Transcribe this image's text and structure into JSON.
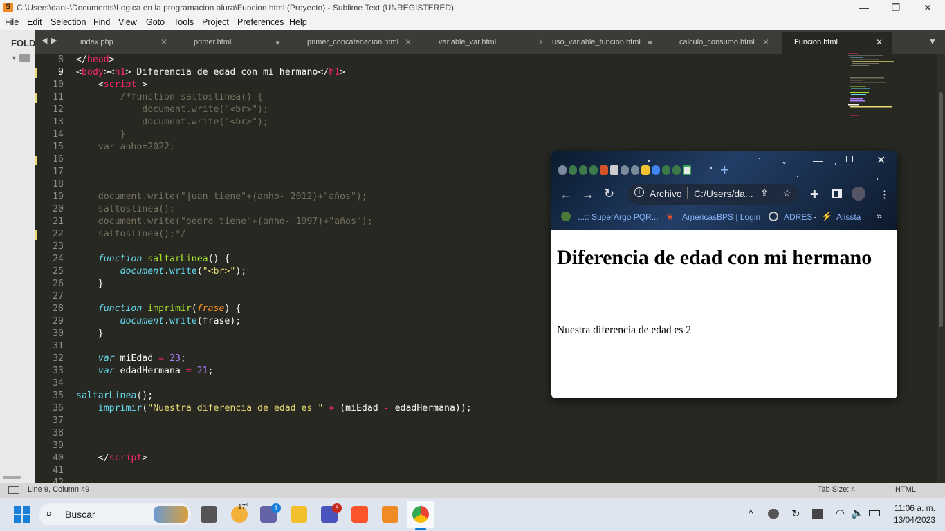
{
  "titlebar": {
    "title": "C:\\Users\\dani-\\Documents\\Logica en la programacion alura\\Funcion.html (Proyecto) - Sublime Text (UNREGISTERED)"
  },
  "menu": [
    "File",
    "Edit",
    "Selection",
    "Find",
    "View",
    "Goto",
    "Tools",
    "Project",
    "Preferences",
    "Help"
  ],
  "sidebar": {
    "label": "FOLD"
  },
  "tabs": [
    {
      "label": "index.php",
      "close": "✕",
      "active": false
    },
    {
      "label": "primer.html",
      "close": "●",
      "active": false
    },
    {
      "label": "primer_concatenacion.html",
      "close": "✕",
      "active": false
    },
    {
      "label": "variable_var.html",
      "close": "✕",
      "active": false
    },
    {
      "label": "uso_variable_funcion.html",
      "close": "●",
      "active": false
    },
    {
      "label": "calculo_consumo.html",
      "close": "✕",
      "active": false
    },
    {
      "label": "Funcion.html",
      "close": "✕",
      "active": true
    }
  ],
  "code_lines": [
    {
      "n": "8",
      "mark": false,
      "html": "<span>&lt;/</span><span class=\"tg\">head</span><span>&gt;</span>"
    },
    {
      "n": "9",
      "mark": true,
      "html": "<span>&lt;</span><span class=\"tg\">body</span><span>&gt;&lt;</span><span class=\"tg\">h1</span><span>&gt; Diferencia de edad con mi hermano&lt;/</span><span class=\"tg\">h1</span><span>&gt;</span>"
    },
    {
      "n": "10",
      "mark": false,
      "html": "    <span>&lt;</span><span class=\"tg\">script</span><span> &gt;</span>"
    },
    {
      "n": "11",
      "mark": true,
      "html": "<span class=\"cm\">        /*function saltoslinea() {</span>"
    },
    {
      "n": "12",
      "mark": false,
      "html": "<span class=\"cm\">            document.write(\"&lt;br&gt;\");</span>"
    },
    {
      "n": "13",
      "mark": false,
      "html": "<span class=\"cm\">            document.write(\"&lt;br&gt;\");</span>"
    },
    {
      "n": "14",
      "mark": false,
      "html": "<span class=\"cm\">        }</span>"
    },
    {
      "n": "15",
      "mark": false,
      "html": "<span class=\"cm\">    var anho=2022;</span>"
    },
    {
      "n": "16",
      "mark": true,
      "html": ""
    },
    {
      "n": "17",
      "mark": false,
      "html": ""
    },
    {
      "n": "18",
      "mark": false,
      "html": ""
    },
    {
      "n": "19",
      "mark": false,
      "html": "<span class=\"cm\">    document.write(\"juan tiene\"+(anho- 2012)+\"años\");</span>"
    },
    {
      "n": "20",
      "mark": false,
      "html": "<span class=\"cm\">    saltoslinea();</span>"
    },
    {
      "n": "21",
      "mark": false,
      "html": "<span class=\"cm\">    document.write(\"pedro tiene\"+(anho- 1997)+\"años\");</span>"
    },
    {
      "n": "22",
      "mark": true,
      "html": "<span class=\"cm\">    saltoslinea();*/</span>"
    },
    {
      "n": "23",
      "mark": false,
      "html": ""
    },
    {
      "n": "24",
      "mark": false,
      "html": "    <span class=\"it\">function</span> <span class=\"fn\">saltarLinea</span>() {"
    },
    {
      "n": "25",
      "mark": false,
      "html": "        <span class=\"it\">document</span>.<span class=\"it\" style=\"font-style:normal\">write</span>(<span class=\"st\">\"&lt;br&gt;\"</span>);"
    },
    {
      "n": "26",
      "mark": false,
      "html": "    }"
    },
    {
      "n": "27",
      "mark": false,
      "html": ""
    },
    {
      "n": "28",
      "mark": false,
      "html": "    <span class=\"it\">function</span> <span class=\"fn\">imprimir</span>(<span class=\"pa\">frase</span>) {"
    },
    {
      "n": "29",
      "mark": false,
      "html": "        <span class=\"it\">document</span>.<span class=\"it\" style=\"font-style:normal\">write</span>(frase);"
    },
    {
      "n": "30",
      "mark": false,
      "html": "    }"
    },
    {
      "n": "31",
      "mark": false,
      "html": ""
    },
    {
      "n": "32",
      "mark": false,
      "html": "    <span class=\"it\">var</span> miEdad <span class=\"kw\">=</span> <span class=\"nm\">23</span>;"
    },
    {
      "n": "33",
      "mark": false,
      "html": "    <span class=\"it\">var</span> edadHermana <span class=\"kw\">=</span> <span class=\"nm\">21</span>;"
    },
    {
      "n": "34",
      "mark": false,
      "html": ""
    },
    {
      "n": "35",
      "mark": false,
      "html": "<span class=\"it\" style=\"font-style:normal\">saltarLinea</span>();"
    },
    {
      "n": "36",
      "mark": false,
      "html": "    <span class=\"it\" style=\"font-style:normal\">imprimir</span>(<span class=\"st\">\"Nuestra diferencia de edad es \"</span> <span class=\"kw\">+</span> (miEdad <span class=\"kw\">-</span> edadHermana));"
    },
    {
      "n": "37",
      "mark": false,
      "html": ""
    },
    {
      "n": "38",
      "mark": false,
      "html": ""
    },
    {
      "n": "39",
      "mark": false,
      "html": ""
    },
    {
      "n": "40",
      "mark": false,
      "html": "    <span>&lt;/</span><span class=\"tg\">script</span><span>&gt;</span>"
    },
    {
      "n": "41",
      "mark": false,
      "html": ""
    },
    {
      "n": "42",
      "mark": false,
      "html": ""
    }
  ],
  "statusbar": {
    "position": "Line 9, Column 49",
    "tab_size": "Tab Size: 4",
    "syntax": "HTML"
  },
  "browser": {
    "address_label": "Archivo",
    "address_url": "C:/Users/da...",
    "bookmarks": [
      "...:: SuperArgo PQR...",
      "AmericasBPS | Login",
      "ADRES",
      "Alissta"
    ],
    "page_heading": "Diferencia de edad con mi hermano",
    "page_text": "Nuestra diferencia de edad es 2"
  },
  "taskbar": {
    "search_label": "Buscar",
    "weather": "17°",
    "time": "11:06 a. m.",
    "date": "13/04/2023",
    "badge_chat": "1",
    "badge_teams": "6"
  },
  "colors": {
    "editor_bg": "#272822",
    "keyword": "#f92672",
    "function": "#a6e22e",
    "string": "#e6db74",
    "number": "#ae81ff",
    "comment": "#75715e",
    "storage": "#66d9ef"
  }
}
